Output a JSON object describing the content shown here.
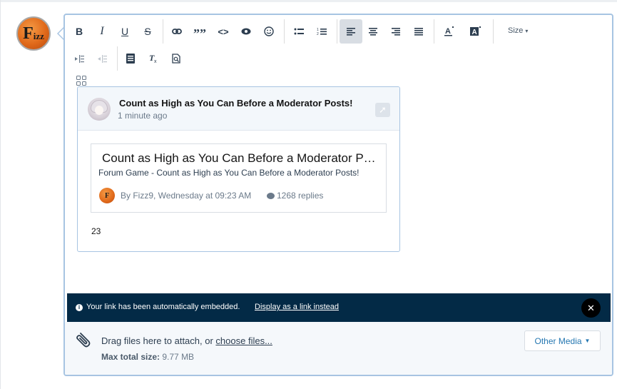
{
  "avatar": {
    "letter_big": "F",
    "letter_small": "izz"
  },
  "toolbar": {
    "bold": "B",
    "italic": "I",
    "underline": "U",
    "strike": "S",
    "quote": "””",
    "code": "<>",
    "size_label": "Size",
    "buttons_row1": [
      "bold-icon",
      "italic-icon",
      "underline-icon",
      "strikethrough-icon",
      "link-icon",
      "quote-icon",
      "code-icon",
      "spoiler-eye-icon",
      "smiley-icon",
      "bullet-list-icon",
      "numbered-list-icon",
      "align-left-icon",
      "align-center-icon",
      "align-right-icon",
      "align-justify-icon",
      "text-color-icon",
      "background-color-icon"
    ],
    "buttons_row2": [
      "indent-icon",
      "outdent-icon",
      "insert-more-icon",
      "clear-format-icon",
      "preview-icon"
    ],
    "active_button": "align-left-icon"
  },
  "embed": {
    "title": "Count as High as You Can Before a Moderator Posts!",
    "time": "1 minute ago",
    "inner": {
      "title": "Count as High as You Can Before a Moderator Posts!",
      "subtitle": "Forum Game - Count as High as You Can Before a Moderator Posts!",
      "mini_avatar": "F",
      "meta": "By Fizz9, Wednesday at 09:23 AM",
      "replies": "1268 replies"
    },
    "count": "23"
  },
  "notice": {
    "message": "Your link has been automatically embedded.",
    "link": "Display as a link instead",
    "close": "✕"
  },
  "attach": {
    "text_prefix": "Drag files here to attach, or ",
    "text_link": "choose files...",
    "max_label": "Max total size:",
    "max_value": "9.77 MB",
    "other_media": "Other Media"
  },
  "colors": {
    "accent": "#2577b1",
    "notice_bg": "#032a46",
    "editor_border": "#a7c4e2"
  }
}
